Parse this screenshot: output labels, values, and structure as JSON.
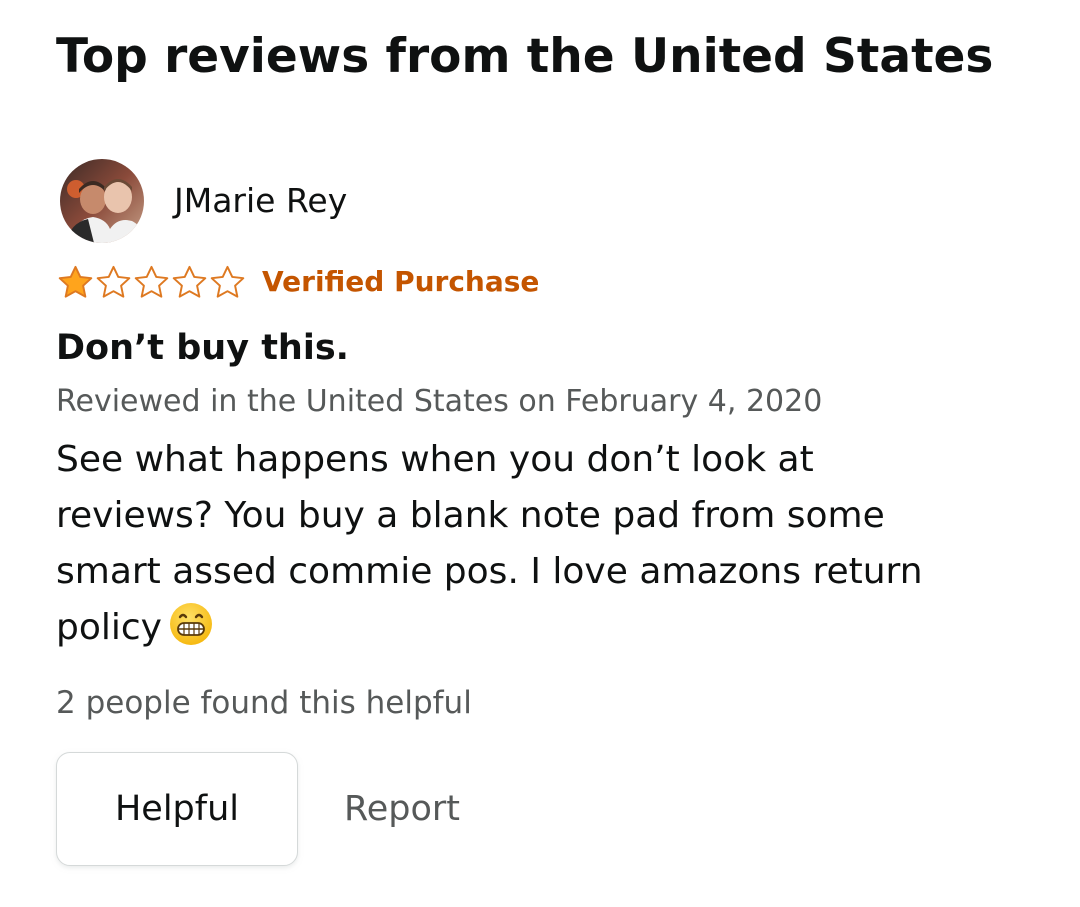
{
  "section": {
    "title": "Top reviews from the United States"
  },
  "review": {
    "reviewer_name": "JMarie Rey",
    "rating": 1,
    "rating_max": 5,
    "star_color": "#ffa41c",
    "verified_label": "Verified Purchase",
    "verified_color": "#c45500",
    "title": "Don’t buy this.",
    "date_text": "Reviewed in the United States on February 4, 2020",
    "body_lines": [
      "See what happens when you don’t look at",
      "reviews? You buy a blank note pad from some",
      "smart assed commie pos. I love amazons return",
      "policy"
    ],
    "body_emoji": "grinning-face-emoji",
    "helpful_count_text": "2 people found this helpful"
  },
  "actions": {
    "helpful_label": "Helpful",
    "report_label": "Report"
  },
  "icons": {
    "avatar": "reviewer-avatar-photo",
    "star_filled": "star-filled-icon",
    "star_empty": "star-outline-icon"
  }
}
